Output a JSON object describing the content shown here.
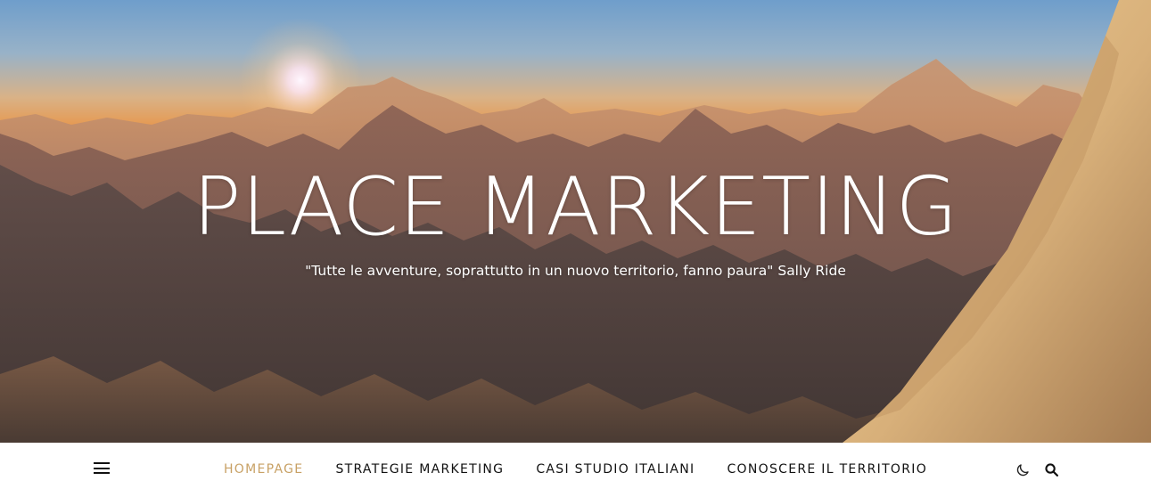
{
  "header": {
    "site_title": "PLACE MARKETING",
    "tagline": "\"Tutte le avventure, soprattutto in un nuovo territorio, fanno paura\" Sally Ride",
    "background": "mountain-sunset-image"
  },
  "nav": {
    "menu_icon": "hamburger-menu-icon",
    "items": [
      {
        "label": "HOMEPAGE",
        "active": true
      },
      {
        "label": "STRATEGIE MARKETING",
        "active": false
      },
      {
        "label": "CASI STUDIO ITALIANI",
        "active": false
      },
      {
        "label": "CONOSCERE IL TERRITORIO",
        "active": false
      }
    ],
    "theme_icon": "moon-icon",
    "search_icon": "search-icon"
  },
  "colors": {
    "accent": "#c8a165",
    "nav_text": "#111111",
    "nav_background": "#ffffff",
    "title_text": "#ffffff"
  }
}
